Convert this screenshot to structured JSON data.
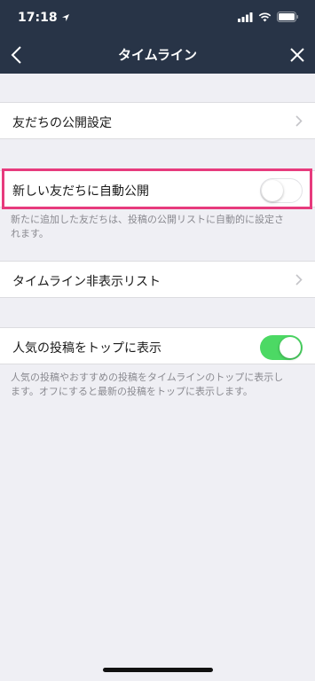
{
  "status": {
    "time": "17:18"
  },
  "nav": {
    "title": "タイムライン"
  },
  "rows": {
    "friends_public": {
      "label": "友だちの公開設定"
    },
    "new_friends_auto": {
      "label": "新しい友だちに自動公開",
      "toggle_on": false
    },
    "hidden_list": {
      "label": "タイムライン非表示リスト"
    },
    "popular_top": {
      "label": "人気の投稿をトップに表示",
      "toggle_on": true
    }
  },
  "descriptions": {
    "new_friends_auto_line1": "新たに追加した友だちは、投稿の公開リストに自動的に設定さ",
    "new_friends_auto_line2": "れます。",
    "popular_top_line1": "人気の投稿やおすすめの投稿をタイムラインのトップに表示し",
    "popular_top_line2": "ます。オフにすると最新の投稿をトップに表示します。"
  },
  "colors": {
    "header_bg": "#283447",
    "highlight_border": "#e73b7d",
    "toggle_on": "#4cd964"
  }
}
